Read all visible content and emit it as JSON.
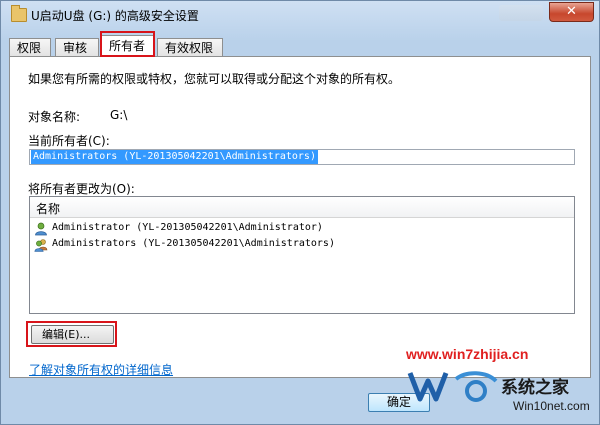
{
  "window": {
    "title": "U启动U盘 (G:) 的高级安全设置",
    "close_glyph": "✕"
  },
  "tabs": [
    {
      "label": "权限",
      "active": false
    },
    {
      "label": "审核",
      "active": false
    },
    {
      "label": "所有者",
      "active": true
    },
    {
      "label": "有效权限",
      "active": false
    }
  ],
  "owner_tab": {
    "intro": "如果您有所需的权限或特权，您就可以取得或分配这个对象的所有权。",
    "object_name_label": "对象名称:",
    "object_name_value": "G:\\",
    "current_owner_label": "当前所有者(C):",
    "current_owner_value": "Administrators (YL-201305042201\\Administrators)",
    "change_owner_label": "将所有者更改为(O):",
    "list_header": "名称",
    "owners": [
      {
        "name": "Administrator (YL-201305042201\\Administrator)",
        "icon": "user-icon"
      },
      {
        "name": "Administrators (YL-201305042201\\Administrators)",
        "icon": "user-group-icon"
      }
    ],
    "edit_button": "编辑(E)...",
    "help_link": "了解对象所有权的详细信息"
  },
  "footer": {
    "ok_button": "确定"
  },
  "watermark": {
    "site": "www.win7zhijia.cn",
    "brand": "系统之家",
    "sub": "Win10net.com"
  },
  "colors": {
    "highlight_border": "#d8141a",
    "selection": "#3399ff",
    "link": "#0066cc"
  }
}
